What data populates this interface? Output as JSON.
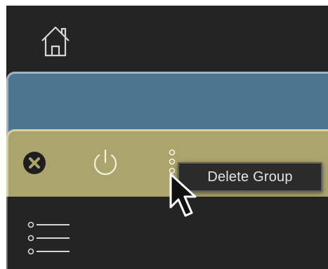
{
  "toolbar": {
    "home_icon": "home-icon"
  },
  "group": {
    "accent_color": "#aba46c",
    "close_icon": "close-circle-icon",
    "power_icon": "power-icon",
    "more_icon": "vertical-dots-icon"
  },
  "context_menu": {
    "items": [
      "Delete Group"
    ]
  },
  "body": {
    "list_icon": "list-icon"
  },
  "colors": {
    "background": "#242424",
    "blue_panel": "#4d7590",
    "yellow_panel": "#aba46c",
    "menu_bg": "#2b2b2b",
    "menu_text": "#e3e3e3"
  }
}
